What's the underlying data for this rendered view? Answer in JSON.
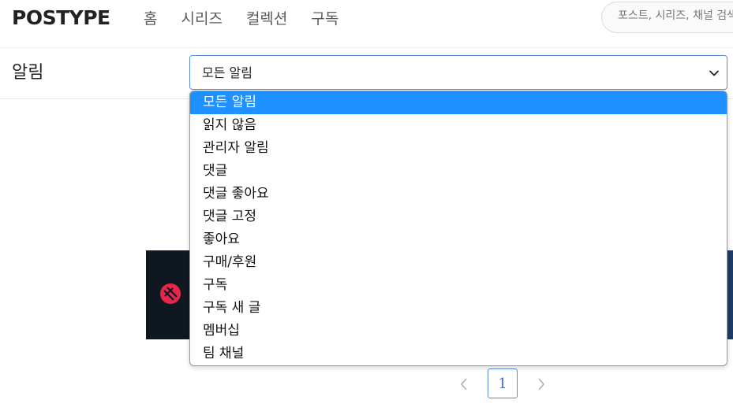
{
  "header": {
    "logo": "POSTYPE",
    "nav": [
      "홈",
      "시리즈",
      "컬렉션",
      "구독"
    ],
    "search_placeholder": "포스트, 시리즈, 채널 검색"
  },
  "subheader": {
    "title": "알림",
    "filter_value": "모든 알림"
  },
  "dropdown": {
    "options": [
      "모든 알림",
      "읽지 않음",
      "관리자 알림",
      "댓글",
      "댓글 좋아요",
      "댓글 고정",
      "좋아요",
      "구매/후원",
      "구독",
      "구독 새 글",
      "멤버십",
      "팀 채널"
    ],
    "selected_index": 0
  },
  "pagination": {
    "current": "1"
  },
  "colors": {
    "accent": "#1e90ff",
    "select_border": "#5b8dd6",
    "logo_mark": "#e8264a"
  }
}
